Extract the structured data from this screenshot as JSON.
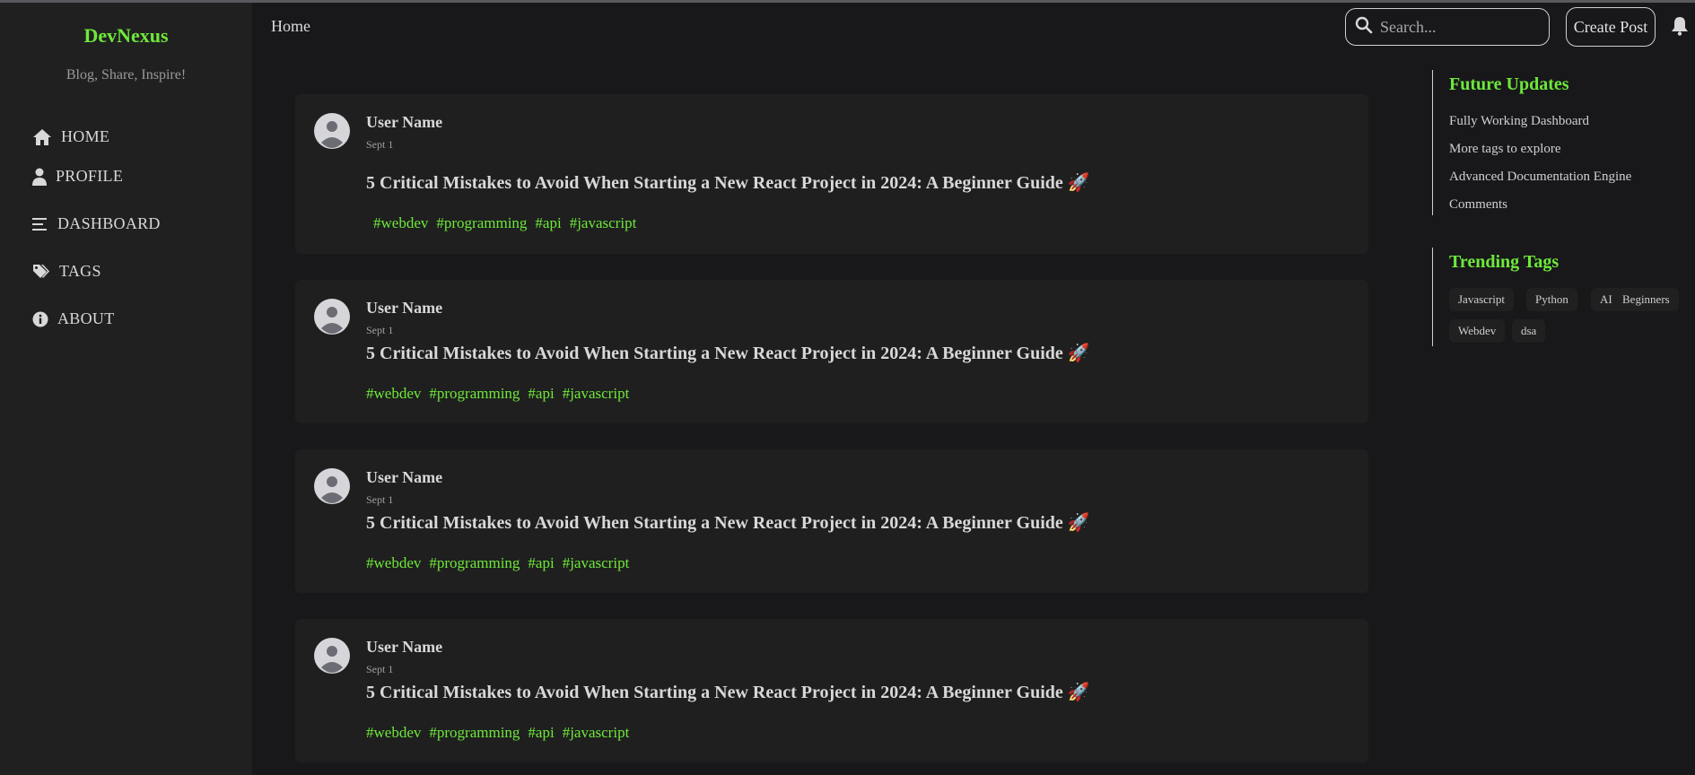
{
  "brand": {
    "name": "DevNexus",
    "tagline": "Blog, Share, Inspire!"
  },
  "sidebar": {
    "items": [
      {
        "label": "HOME",
        "icon": "home-icon"
      },
      {
        "label": "PROFILE",
        "icon": "user-icon"
      },
      {
        "label": "DASHBOARD",
        "icon": "menu-lines-icon"
      },
      {
        "label": "TAGS",
        "icon": "tags-icon"
      },
      {
        "label": "ABOUT",
        "icon": "info-icon"
      }
    ]
  },
  "header": {
    "breadcrumb": "Home",
    "search_placeholder": "Search...",
    "create_post_label": "Create Post"
  },
  "posts": [
    {
      "user": "User Name",
      "date": "Sept 1",
      "title": "5 Critical Mistakes to Avoid When Starting a New React Project in 2024: A Beginner Guide 🚀",
      "tags": [
        "#webdev",
        "#programming",
        "#api",
        "#javascript"
      ]
    },
    {
      "user": "User Name",
      "date": "Sept 1",
      "title": "5 Critical Mistakes to Avoid When Starting a New React Project in 2024: A Beginner Guide 🚀",
      "tags": [
        "#webdev",
        "#programming",
        "#api",
        "#javascript"
      ]
    },
    {
      "user": "User Name",
      "date": "Sept 1",
      "title": "5 Critical Mistakes to Avoid When Starting a New React Project in 2024: A Beginner Guide 🚀",
      "tags": [
        "#webdev",
        "#programming",
        "#api",
        "#javascript"
      ]
    },
    {
      "user": "User Name",
      "date": "Sept 1",
      "title": "5 Critical Mistakes to Avoid When Starting a New React Project in 2024: A Beginner Guide 🚀",
      "tags": [
        "#webdev",
        "#programming",
        "#api",
        "#javascript"
      ]
    }
  ],
  "future_updates": {
    "title": "Future Updates",
    "items": [
      "Fully Working Dashboard",
      "More tags to explore",
      "Advanced Documentation Engine",
      "Comments"
    ]
  },
  "trending_tags": {
    "title": "Trending Tags",
    "items": [
      "Javascript",
      "Python",
      "AI",
      "Beginners",
      "Webdev",
      "dsa"
    ]
  },
  "colors": {
    "accent": "#6ee83a",
    "background": "#18181b",
    "panel": "#1f1f1f",
    "sidebar": "#202020"
  }
}
